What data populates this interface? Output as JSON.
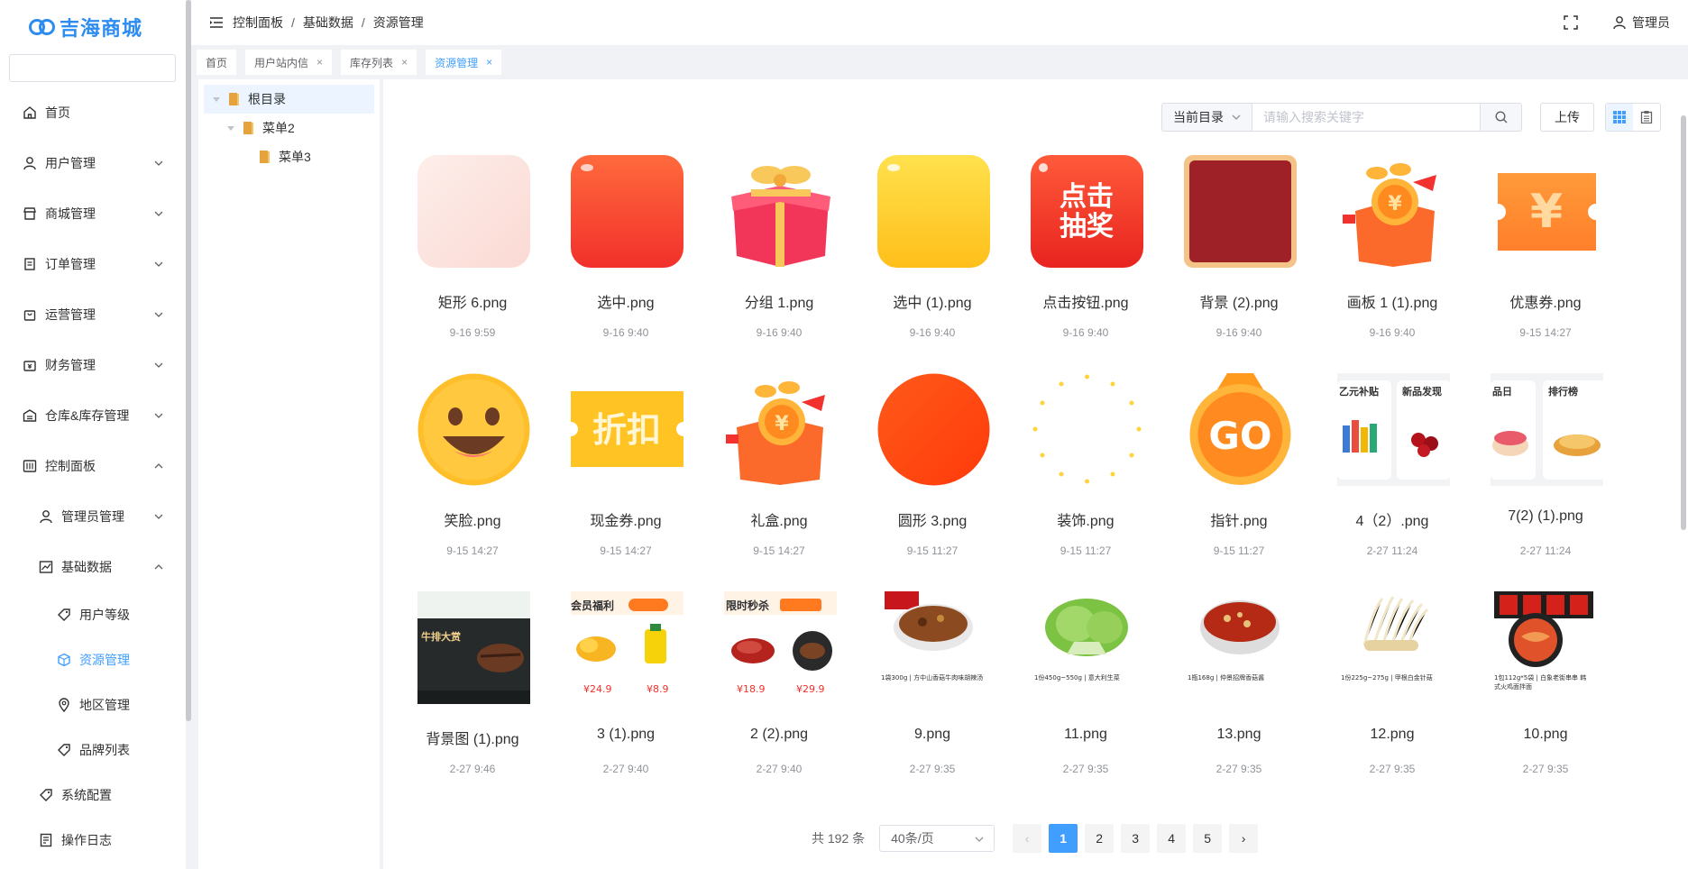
{
  "brand": {
    "name": "吉海商城"
  },
  "colors": {
    "accent": "#409eff",
    "brand": "#2d8cf0"
  },
  "sidebar": {
    "search_placeholder": "",
    "items": [
      {
        "label": "首页",
        "icon": "home-icon"
      },
      {
        "label": "用户管理",
        "icon": "user-icon"
      },
      {
        "label": "商城管理",
        "icon": "store-icon"
      },
      {
        "label": "订单管理",
        "icon": "order-icon"
      },
      {
        "label": "运营管理",
        "icon": "bag-icon"
      },
      {
        "label": "财务管理",
        "icon": "wallet-icon"
      },
      {
        "label": "仓库&库存管理",
        "icon": "warehouse-icon"
      },
      {
        "label": "控制面板",
        "icon": "sliders-icon"
      },
      {
        "label": "管理员管理",
        "icon": "admin-icon"
      },
      {
        "label": "基础数据",
        "icon": "chart-icon"
      },
      {
        "label": "用户等级",
        "icon": "tag-icon"
      },
      {
        "label": "资源管理",
        "icon": "box-icon"
      },
      {
        "label": "地区管理",
        "icon": "location-icon"
      },
      {
        "label": "品牌列表",
        "icon": "tag-icon"
      },
      {
        "label": "系统配置",
        "icon": "tag-icon"
      },
      {
        "label": "操作日志",
        "icon": "log-icon"
      }
    ]
  },
  "header": {
    "breadcrumb": [
      "控制面板",
      "基础数据",
      "资源管理"
    ],
    "separator": "/",
    "user": "管理员"
  },
  "tabs": [
    {
      "label": "首页",
      "closable": false
    },
    {
      "label": "用户站内信",
      "closable": true
    },
    {
      "label": "库存列表",
      "closable": true
    },
    {
      "label": "资源管理",
      "closable": true,
      "active": true
    }
  ],
  "tab_close_glyph": "×",
  "tree": [
    {
      "label": "根目录",
      "level": 0
    },
    {
      "label": "菜单2",
      "level": 1
    },
    {
      "label": "菜单3",
      "level": 2
    }
  ],
  "toolbar": {
    "scope": "当前目录",
    "search_placeholder": "请输入搜索关键字",
    "upload": "上传"
  },
  "files": [
    {
      "name": "矩形 6.png",
      "date": "9-16 9:59"
    },
    {
      "name": "选中.png",
      "date": "9-16 9:40"
    },
    {
      "name": "分组 1.png",
      "date": "9-16 9:40"
    },
    {
      "name": "选中 (1).png",
      "date": "9-16 9:40"
    },
    {
      "name": "点击按钮.png",
      "date": "9-16 9:40",
      "text": "点击\n抽奖"
    },
    {
      "name": "背景 (2).png",
      "date": "9-16 9:40"
    },
    {
      "name": "画板 1 (1).png",
      "date": "9-16 9:40"
    },
    {
      "name": "优惠券.png",
      "date": "9-15 14:27",
      "text": "¥"
    },
    {
      "name": "笑脸.png",
      "date": "9-15 14:27"
    },
    {
      "name": "现金券.png",
      "date": "9-15 14:27",
      "text": "折扣"
    },
    {
      "name": "礼盒.png",
      "date": "9-15 14:27"
    },
    {
      "name": "圆形 3.png",
      "date": "9-15 11:27"
    },
    {
      "name": "装饰.png",
      "date": "9-15 11:27"
    },
    {
      "name": "指针.png",
      "date": "9-15 11:27",
      "text": "GO"
    },
    {
      "name": "4（2）.png",
      "date": "2-27 11:24",
      "text": [
        "乙元补贴",
        "新品发现"
      ]
    },
    {
      "name": "7(2) (1).png",
      "date": "2-27 11:24",
      "text": [
        "品日",
        "排行榜"
      ]
    },
    {
      "name": "背景图 (1).png",
      "date": "2-27 9:46",
      "text": "牛排大赏"
    },
    {
      "name": "3 (1).png",
      "date": "2-27 9:40",
      "text": [
        "会员福利",
        "¥24.9",
        "¥8.9"
      ]
    },
    {
      "name": "2 (2).png",
      "date": "2-27 9:40",
      "text": [
        "限时秒杀",
        "¥18.9",
        "¥29.9"
      ]
    },
    {
      "name": "9.png",
      "date": "2-27 9:35",
      "text": "1袋300g | 方中山香菇牛肉味胡辣汤"
    },
    {
      "name": "11.png",
      "date": "2-27 9:35",
      "text": "1份450g~550g | 意大利生菜"
    },
    {
      "name": "13.png",
      "date": "2-27 9:35",
      "text": "1瓶168g | 仲景招牌香菇酱"
    },
    {
      "name": "12.png",
      "date": "2-27 9:35",
      "text": "1份225g~275g | 甲根白金针菇"
    },
    {
      "name": "10.png",
      "date": "2-27 9:35",
      "text": "1包112g*5袋 | 白象老街串串 韩式火鸡面拌面"
    }
  ],
  "pagination": {
    "total": "共 192 条",
    "page_size": "40条/页",
    "pages": [
      "1",
      "2",
      "3",
      "4",
      "5"
    ],
    "current": "1",
    "prev": "‹",
    "next": "›"
  }
}
